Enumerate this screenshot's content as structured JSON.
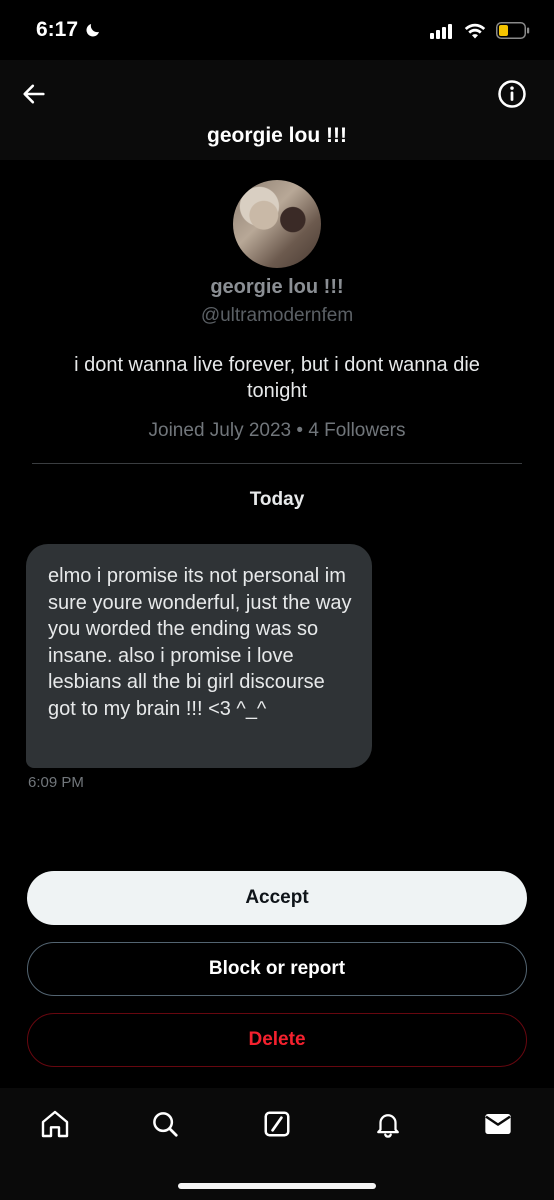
{
  "status_bar": {
    "time": "6:17",
    "moon_icon": "moon-icon",
    "signal_icon": "signal-icon",
    "wifi_icon": "wifi-icon",
    "battery_icon": "battery-icon",
    "battery_color": "#f5c400"
  },
  "header": {
    "title": "georgie lou !!!",
    "back_icon": "arrow-left-icon",
    "info_icon": "info-icon"
  },
  "profile": {
    "name": "georgie lou !!!",
    "handle": "@ultramodernfem",
    "bio": "i dont wanna live forever, but i dont wanna die tonight",
    "meta": "Joined July 2023 • 4 Followers"
  },
  "conversation": {
    "date_label": "Today",
    "messages": [
      {
        "text": "elmo i promise its not personal im sure youre wonderful, just the way you worded the ending was so insane. also i promise i love lesbians all the bi girl discourse got to my brain !!! <3 ^_^",
        "time": "6:09 PM"
      }
    ]
  },
  "actions": {
    "accept": "Accept",
    "block_or_report": "Block or report",
    "delete": "Delete",
    "delete_color": "#f4212e"
  },
  "bottom_nav": {
    "items": [
      {
        "icon": "home-icon"
      },
      {
        "icon": "search-icon"
      },
      {
        "icon": "grok-icon"
      },
      {
        "icon": "bell-icon"
      },
      {
        "icon": "mail-icon"
      }
    ]
  }
}
